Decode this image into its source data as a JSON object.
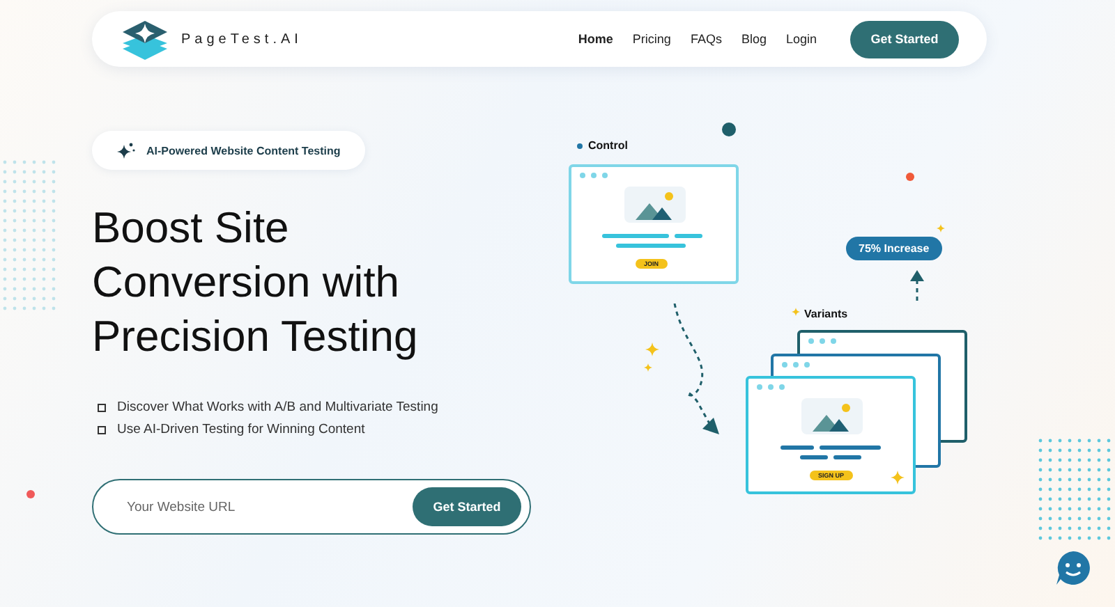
{
  "nav": {
    "brand": "PageTest.AI",
    "links": [
      {
        "label": "Home",
        "selected": true
      },
      {
        "label": "Pricing",
        "selected": false
      },
      {
        "label": "FAQs",
        "selected": false
      },
      {
        "label": "Blog",
        "selected": false
      },
      {
        "label": "Login",
        "selected": false
      }
    ],
    "cta": "Get Started"
  },
  "hero": {
    "badge": "AI-Powered Website Content Testing",
    "title": [
      "Boost Site",
      "Conversion with",
      "Precision Testing"
    ],
    "bullets": [
      "Discover What Works with A/B and Multivariate Testing",
      "Use AI-Driven Testing for Winning Content"
    ],
    "url_field": {
      "placeholder": "Your Website URL"
    },
    "submit": "Get Started"
  },
  "illustration": {
    "control_label": "Control",
    "control_button": "JOIN",
    "increase": "75% Increase",
    "variants_label": "Variants",
    "variant_button": "SIGN UP"
  }
}
